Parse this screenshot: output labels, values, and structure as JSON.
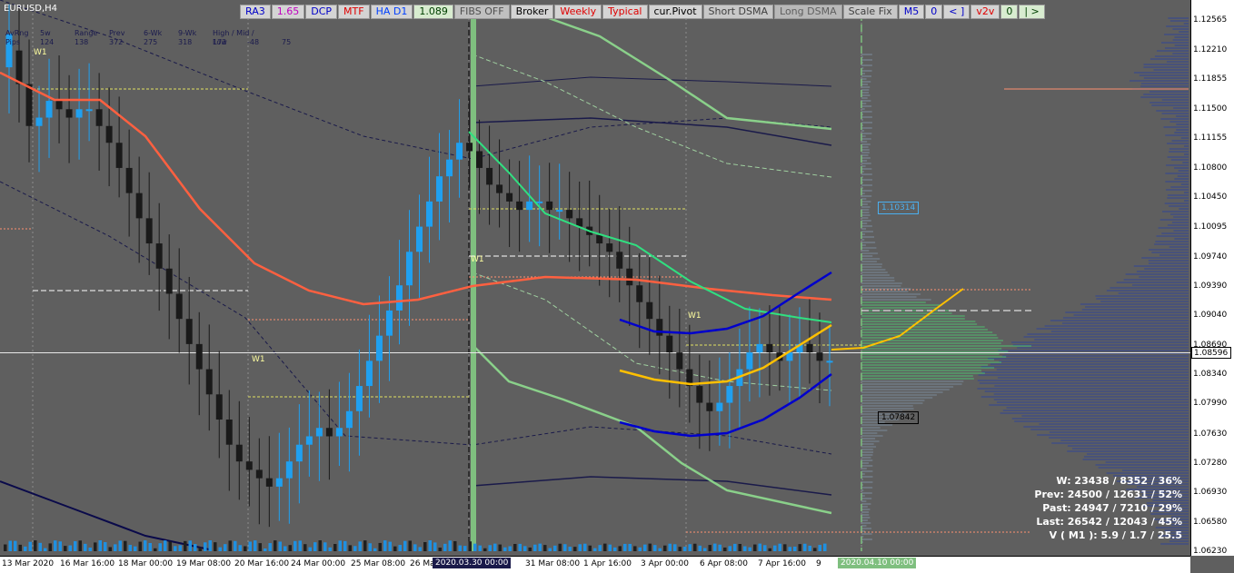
{
  "window": {
    "symbol": "EURUSD,H4"
  },
  "toolbar": [
    {
      "label": "RA3",
      "bg": "#d4d4d4",
      "color": "#0000c8"
    },
    {
      "label": "1.65",
      "bg": "#d4d4d4",
      "color": "#c000c0"
    },
    {
      "label": "DCP",
      "bg": "#d4d4d4",
      "color": "#0000c8"
    },
    {
      "label": "MTF",
      "bg": "#d4d4d4",
      "color": "#e00000"
    },
    {
      "label": "HA D1",
      "bg": "#d4d4d4",
      "color": "#0040ff"
    },
    {
      "label": "1.089",
      "bg": "#d8ecd0",
      "color": "#004000"
    },
    {
      "label": "FIBS OFF",
      "bg": "#c0c0c0",
      "color": "#505050"
    },
    {
      "label": "Broker",
      "bg": "#d4d4d4",
      "color": "#000000"
    },
    {
      "label": "Weekly",
      "bg": "#d4d4d4",
      "color": "#e00000"
    },
    {
      "label": "Typical",
      "bg": "#d4d4d4",
      "color": "#e00000"
    },
    {
      "label": "cur.Pivot",
      "bg": "#d4d4d4",
      "color": "#000000"
    },
    {
      "label": "Short DSMA",
      "bg": "#c8c8c8",
      "color": "#404040"
    },
    {
      "label": "Long DSMA",
      "bg": "#b8b8b8",
      "color": "#606060"
    },
    {
      "label": "Scale Fix",
      "bg": "#c8c8c8",
      "color": "#404040"
    },
    {
      "label": "M5",
      "bg": "#d4d4d4",
      "color": "#0000c8"
    },
    {
      "label": "0",
      "bg": "#d4d4d4",
      "color": "#0000c8"
    },
    {
      "label": "< ]",
      "bg": "#d4d4d4",
      "color": "#0000c8"
    },
    {
      "label": "v2v",
      "bg": "#d4d4d4",
      "color": "#e00000"
    },
    {
      "label": "0",
      "bg": "#d8ecd0",
      "color": "#004000"
    },
    {
      "label": "| >",
      "bg": "#d8ecd0",
      "color": "#004000"
    }
  ],
  "stats": {
    "headers": [
      "AvRng",
      "5w",
      "Range",
      "Prev",
      "6-Wk",
      "9-Wk",
      "High / Mid / Low"
    ],
    "values": [
      "Pips",
      "124",
      "138",
      "372",
      "275",
      "318",
      "172",
      "-48",
      "75"
    ]
  },
  "summary": {
    "line1": "W: 23438 / 8352 / 36%",
    "line2": "Prev: 24500 / 12631 / 52%",
    "line3": "Past: 24947 / 7210 / 29%",
    "line4": "Last: 26542 / 12043 / 45%",
    "line5": "V ( M1 ): 5.9 / 1.7 / 25.5"
  },
  "markers": {
    "level_high": "1.10314",
    "level_low": "1.07842",
    "w1": "W1",
    "current_price": "1.08596"
  },
  "crosshair_times": {
    "left": "2020.03.30 00:00",
    "right": "2020.04.10 00:00"
  },
  "chart_data": {
    "type": "candlestick",
    "symbol": "EURUSD",
    "timeframe": "H4",
    "ylim": [
      1.0623,
      1.1264
    ],
    "price_ticks": [
      "1.12565",
      "1.12210",
      "1.11855",
      "1.11500",
      "1.11155",
      "1.10800",
      "1.10450",
      "1.10095",
      "1.09740",
      "1.09390",
      "1.09040",
      "1.08690",
      "1.08340",
      "1.07990",
      "1.07630",
      "1.07280",
      "1.06930",
      "1.06580",
      "1.06230"
    ],
    "time_labels": [
      "13 Mar 2020",
      "16 Mar 16:00",
      "18 Mar 00:00",
      "19 Mar 08:00",
      "20 Mar 16:00",
      "24 Mar 00:00",
      "25 Mar 08:00",
      "26 Mar",
      "31 Mar 08:00",
      "1 Apr 16:00",
      "3 Apr 00:00",
      "6 Apr 08:00",
      "7 Apr 16:00",
      "9"
    ],
    "current_price": 1.08596,
    "levels": [
      1.10314,
      1.07842
    ],
    "price_path": [
      [
        1.12,
        1.124
      ],
      [
        1.122,
        1.118
      ],
      [
        1.118,
        1.113
      ],
      [
        1.113,
        1.114
      ],
      [
        1.114,
        1.116
      ],
      [
        1.116,
        1.115
      ],
      [
        1.115,
        1.114
      ],
      [
        1.114,
        1.115
      ],
      [
        1.115,
        1.115
      ],
      [
        1.115,
        1.113
      ],
      [
        1.113,
        1.111
      ],
      [
        1.111,
        1.108
      ],
      [
        1.108,
        1.105
      ],
      [
        1.105,
        1.102
      ],
      [
        1.102,
        1.099
      ],
      [
        1.099,
        1.096
      ],
      [
        1.096,
        1.093
      ],
      [
        1.093,
        1.09
      ],
      [
        1.09,
        1.087
      ],
      [
        1.087,
        1.084
      ],
      [
        1.084,
        1.081
      ],
      [
        1.081,
        1.078
      ],
      [
        1.078,
        1.075
      ],
      [
        1.075,
        1.073
      ],
      [
        1.073,
        1.072
      ],
      [
        1.072,
        1.071
      ],
      [
        1.071,
        1.07
      ],
      [
        1.07,
        1.071
      ],
      [
        1.071,
        1.073
      ],
      [
        1.073,
        1.075
      ],
      [
        1.075,
        1.076
      ],
      [
        1.076,
        1.077
      ],
      [
        1.077,
        1.076
      ],
      [
        1.076,
        1.077
      ],
      [
        1.077,
        1.079
      ],
      [
        1.079,
        1.082
      ],
      [
        1.082,
        1.085
      ],
      [
        1.085,
        1.088
      ],
      [
        1.088,
        1.091
      ],
      [
        1.091,
        1.094
      ],
      [
        1.094,
        1.098
      ],
      [
        1.098,
        1.101
      ],
      [
        1.101,
        1.104
      ],
      [
        1.104,
        1.107
      ],
      [
        1.107,
        1.109
      ],
      [
        1.109,
        1.111
      ],
      [
        1.111,
        1.11
      ],
      [
        1.11,
        1.108
      ],
      [
        1.108,
        1.106
      ],
      [
        1.106,
        1.105
      ],
      [
        1.105,
        1.104
      ],
      [
        1.104,
        1.103
      ],
      [
        1.103,
        1.104
      ],
      [
        1.104,
        1.104
      ],
      [
        1.104,
        1.103
      ],
      [
        1.103,
        1.103
      ],
      [
        1.103,
        1.102
      ],
      [
        1.102,
        1.101
      ],
      [
        1.101,
        1.1
      ],
      [
        1.1,
        1.099
      ],
      [
        1.099,
        1.098
      ],
      [
        1.098,
        1.096
      ],
      [
        1.096,
        1.094
      ],
      [
        1.094,
        1.092
      ],
      [
        1.092,
        1.09
      ],
      [
        1.09,
        1.088
      ],
      [
        1.088,
        1.086
      ],
      [
        1.086,
        1.084
      ],
      [
        1.084,
        1.082
      ],
      [
        1.082,
        1.08
      ],
      [
        1.08,
        1.079
      ],
      [
        1.079,
        1.08
      ],
      [
        1.08,
        1.082
      ],
      [
        1.082,
        1.084
      ],
      [
        1.084,
        1.086
      ],
      [
        1.086,
        1.087
      ],
      [
        1.087,
        1.086
      ],
      [
        1.086,
        1.085
      ],
      [
        1.085,
        1.086
      ],
      [
        1.086,
        1.087
      ],
      [
        1.087,
        1.086
      ],
      [
        1.086,
        1.085
      ],
      [
        1.085,
        1.085
      ]
    ]
  }
}
